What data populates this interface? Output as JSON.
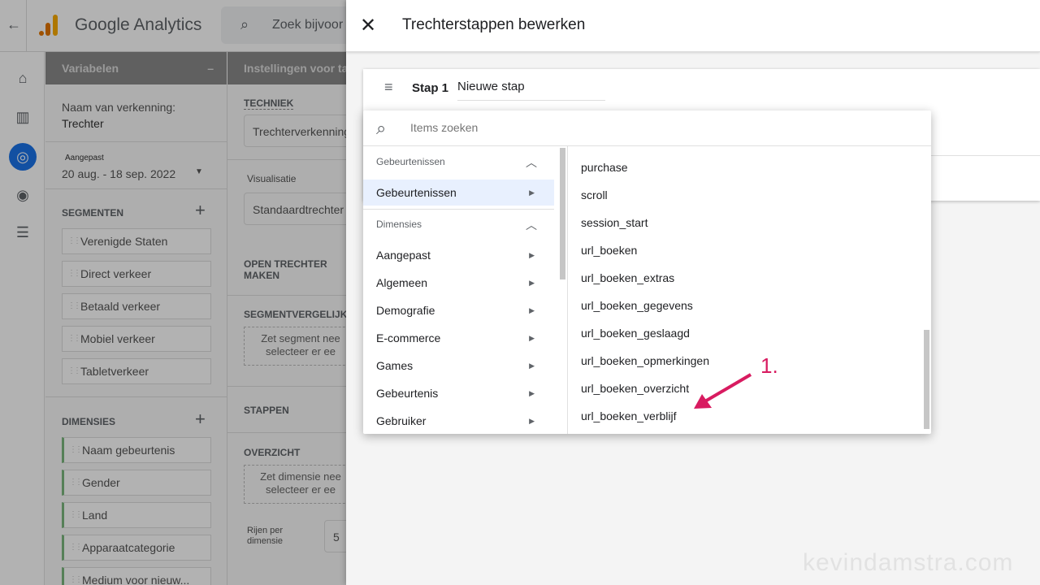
{
  "app": {
    "title": "Google Analytics",
    "search_placeholder": "Zoek bijvoor"
  },
  "variables": {
    "header": "Variabelen",
    "collapse": "–",
    "name_label": "Naam van verkenning:",
    "name_value": "Trechter",
    "date_tag": "Aangepast",
    "date_range": "20 aug. - 18 sep. 2022",
    "segments_label": "SEGMENTEN",
    "segments": [
      "Verenigde Staten",
      "Direct verkeer",
      "Betaald verkeer",
      "Mobiel verkeer",
      "Tabletverkeer"
    ],
    "dimensions_label": "DIMENSIES",
    "dimensions": [
      "Naam gebeurtenis",
      "Gender",
      "Land",
      "Apparaatcategorie",
      "Medium voor nieuw..."
    ]
  },
  "settings": {
    "header": "Instellingen voor tab",
    "technique_label": "TECHNIEK",
    "technique_value": "Trechterverkenning",
    "visual_label": "Visualisatie",
    "visual_value": "Standaardtrechter",
    "open_funnel": "OPEN TRECHTER MAKEN",
    "segment_compare": "SEGMENTVERGELIJKIN",
    "segment_drop": "Zet segment nee selecteer er ee",
    "steps": "STAPPEN",
    "overview": "OVERZICHT",
    "dim_drop": "Zet dimensie nee selecteer er ee",
    "rows_label": "Rijen per dimensie",
    "rows_value": "5"
  },
  "panel": {
    "title": "Trechterstappen bewerken",
    "step_label": "Stap 1",
    "step_name": "Nieuwe stap",
    "search_placeholder": "Items zoeken",
    "groups": [
      {
        "label": "Gebeurtenissen",
        "items": [
          "Gebeurtenissen"
        ]
      },
      {
        "label": "Dimensies",
        "items": [
          "Aangepast",
          "Algemeen",
          "Demografie",
          "E-commerce",
          "Games",
          "Gebeurtenis",
          "Gebruiker"
        ]
      }
    ],
    "events": [
      "purchase",
      "scroll",
      "session_start",
      "url_boeken",
      "url_boeken_extras",
      "url_boeken_gegevens",
      "url_boeken_geslaagd",
      "url_boeken_opmerkingen",
      "url_boeken_overzicht",
      "url_boeken_verblijf"
    ]
  },
  "annotation": {
    "label": "1.",
    "color": "#d81b60"
  },
  "watermark": "kevindamstra.com"
}
